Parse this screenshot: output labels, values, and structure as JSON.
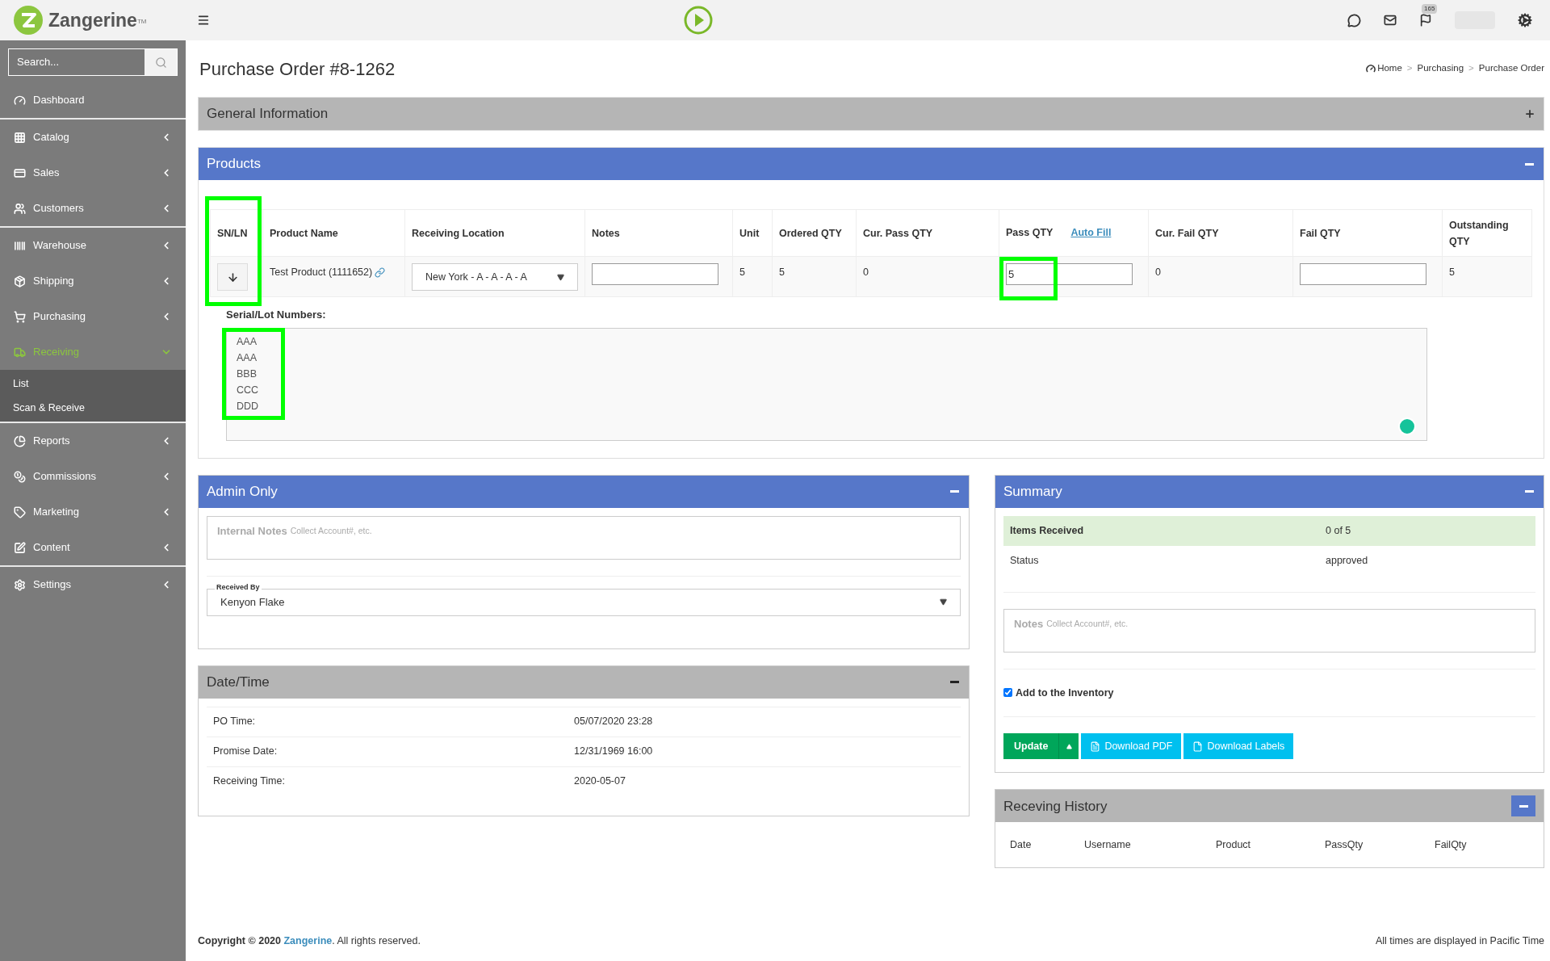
{
  "brand": {
    "name": "Zangerine",
    "mark": "TM"
  },
  "topbar": {
    "notifications": "165"
  },
  "sidebar": {
    "search": {
      "placeholder": "Search..."
    },
    "sections": [
      [
        {
          "label": "Dashboard",
          "selected": false,
          "has_arrow": false
        }
      ],
      [
        {
          "label": "Catalog",
          "selected": false,
          "has_arrow": true
        },
        {
          "label": "Sales",
          "selected": false,
          "has_arrow": true
        },
        {
          "label": "Customers",
          "selected": false,
          "has_arrow": true
        }
      ],
      [
        {
          "label": "Warehouse",
          "selected": false,
          "has_arrow": true
        },
        {
          "label": "Shipping",
          "selected": false,
          "has_arrow": true
        },
        {
          "label": "Purchasing",
          "selected": false,
          "has_arrow": true
        },
        {
          "label": "Receiving",
          "selected": true,
          "has_arrow": true,
          "expanded": true,
          "children": [
            {
              "label": "List"
            },
            {
              "label": "Scan & Receive"
            }
          ]
        }
      ],
      [
        {
          "label": "Reports",
          "selected": false,
          "has_arrow": true
        },
        {
          "label": "Commissions",
          "selected": false,
          "has_arrow": true
        },
        {
          "label": "Marketing",
          "selected": false,
          "has_arrow": true
        },
        {
          "label": "Content",
          "selected": false,
          "has_arrow": true
        }
      ],
      [
        {
          "label": "Settings",
          "selected": false,
          "has_arrow": true
        }
      ]
    ]
  },
  "page": {
    "title": "Purchase Order #8-1262",
    "breadcrumb": [
      "Home",
      "Purchasing",
      "Purchase Order"
    ],
    "breadcrumb_separator": ">"
  },
  "general": {
    "title": "General Information",
    "kind": "default",
    "expanded": false
  },
  "products": {
    "title": "Products",
    "kind": "primary",
    "expanded": true,
    "columns": [
      "SN/LN",
      "Product Name",
      "Receiving Location",
      "Notes",
      "Unit",
      "Ordered QTY",
      "Cur. Pass QTY",
      "Pass QTY",
      "Cur. Fail QTY",
      "Fail QTY",
      "Outstanding QTY"
    ],
    "auto_fill": "Auto Fill",
    "row": {
      "product": "Test Product (1111652)",
      "location": "New York - A - A - A - A",
      "unit": "5",
      "ordered": "5",
      "cur_pass": "0",
      "pass": "5",
      "cur_fail": "0",
      "outstanding": "5"
    },
    "serial_label": "Serial/Lot Numbers:",
    "serials": [
      "AAA",
      "AAA",
      "BBB",
      "CCC",
      "DDD"
    ]
  },
  "admin": {
    "title": "Admin Only",
    "kind": "primary",
    "expanded": true,
    "notes_label": "Internal Notes",
    "notes_placeholder": "Collect Account#, etc.",
    "received_by_label": "Received By",
    "received_by": "Kenyon Flake"
  },
  "datetime": {
    "title": "Date/Time",
    "kind": "default",
    "expanded": true,
    "rows": [
      {
        "label": "PO Time:",
        "value": "05/07/2020 23:28"
      },
      {
        "label": "Promise Date:",
        "value": "12/31/1969 16:00"
      },
      {
        "label": "Receiving Time:",
        "value": "2020-05-07"
      }
    ]
  },
  "summary": {
    "title": "Summary",
    "kind": "primary",
    "expanded": true,
    "rows": [
      {
        "label": "Items Received",
        "value": "0 of 5",
        "highlighted": true
      },
      {
        "label": "Status",
        "value": "approved",
        "highlighted": false
      }
    ],
    "notes_label": "Notes",
    "notes_placeholder": "Collect Account#, etc.",
    "inventory": {
      "label": "Add to the Inventory",
      "checked": true
    },
    "buttons": [
      "Update",
      "Download PDF",
      "Download Labels"
    ]
  },
  "history": {
    "title": "Receving History",
    "kind": "default",
    "expanded": true,
    "columns": [
      "Date",
      "Username",
      "Product",
      "PassQty",
      "FailQty"
    ]
  },
  "footer": {
    "copyright": "Copyright © 2020",
    "brand": "Zangerine",
    "rights": ". All rights reserved.",
    "timezone": "All times are displayed in Pacific Time"
  }
}
